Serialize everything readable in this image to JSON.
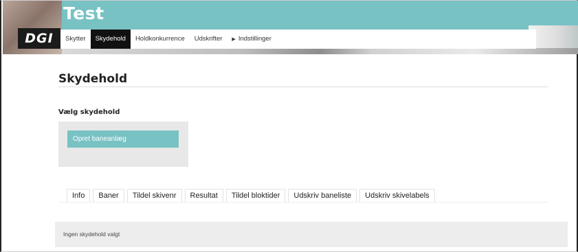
{
  "header": {
    "site_title": "Test",
    "logo_text": "DGI"
  },
  "nav": {
    "items": [
      {
        "label": "Skytter",
        "active": false
      },
      {
        "label": "Skydehold",
        "active": true
      },
      {
        "label": "Holdkonkurrence",
        "active": false
      },
      {
        "label": "Udskrifter",
        "active": false
      },
      {
        "label": "Indstillinger",
        "active": false
      }
    ],
    "settings_arrow": "▶"
  },
  "main": {
    "page_title": "Skydehold",
    "select_label": "Vælg skydehold",
    "create_button": "Opret baneanlæg",
    "tabs": [
      "Info",
      "Baner",
      "Tildel skivenr",
      "Resultat",
      "Tildel bloktider",
      "Udskriv baneliste",
      "Udskriv skivelabels"
    ],
    "status_text": "Ingen skydehold valgt"
  },
  "colors": {
    "accent": "#78c2c4",
    "nav_active_bg": "#111111",
    "panel_bg": "#e8e8e8"
  }
}
